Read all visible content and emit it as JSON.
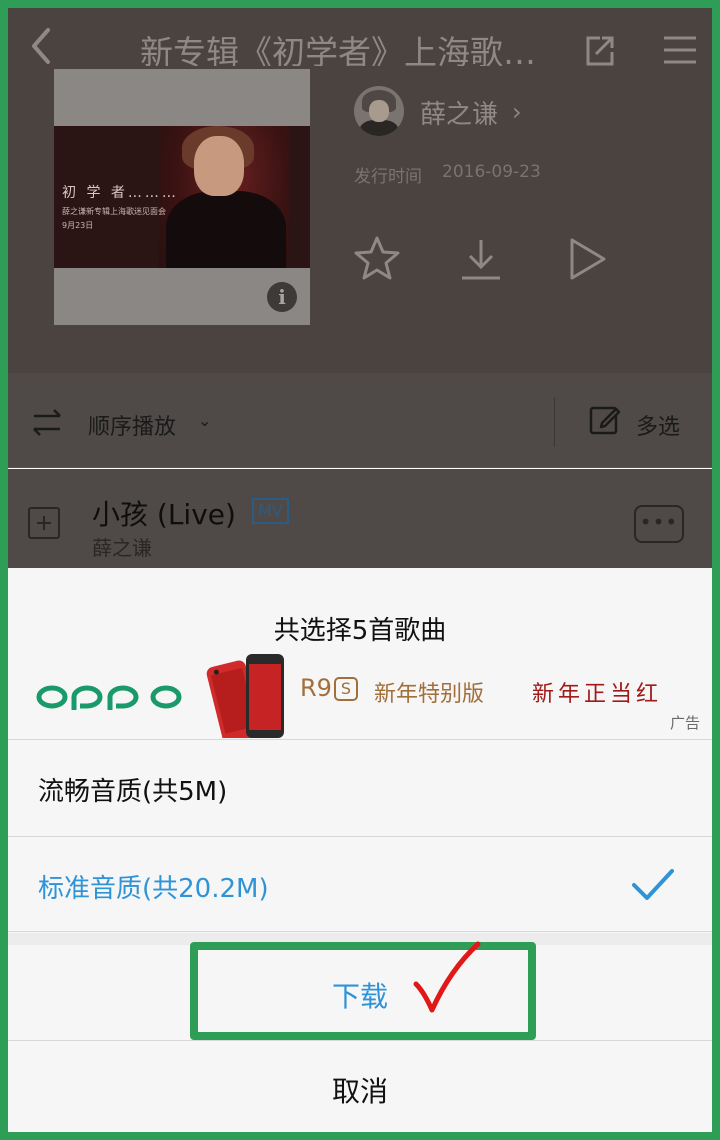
{
  "header": {
    "title": "新专辑《初学者》上海歌…",
    "artist": "薛之谦",
    "release_label": "发行时间",
    "release_date": "2016-09-23",
    "cover": {
      "line1": "初 学 者………",
      "line2": "薛之谦新专辑上海歌迷见面会",
      "line3": "9月23日"
    }
  },
  "toolbar": {
    "sequence_label": "顺序播放",
    "multi_select_label": "多选"
  },
  "song": {
    "title": "小孩 (Live)",
    "badge": "MV",
    "artist": "薛之谦"
  },
  "sheet": {
    "title": "共选择5首歌曲",
    "ad": {
      "brand": "OPPO",
      "model": "R9",
      "model_badge": "S",
      "edition": "新年特别版",
      "slogan": "新年正当红",
      "label": "广告"
    },
    "options": [
      {
        "label": "流畅音质(共5M)",
        "selected": false
      },
      {
        "label": "标准音质(共20.2M)",
        "selected": true
      }
    ],
    "download_label": "下载",
    "cancel_label": "取消"
  },
  "colors": {
    "accent_blue": "#2f93d8",
    "annotation_green": "#2e9e57",
    "annotation_red": "#e01818",
    "dim_overlay": "#4a4340",
    "ad_gold": "#a26f3a",
    "oppo_green": "#1a9a6a"
  },
  "icons": {
    "back": "chevron-left-icon",
    "share": "share-icon",
    "menu": "hamburger-menu-icon",
    "favorite": "star-icon",
    "download": "download-icon",
    "play": "play-icon",
    "sequence": "swap-arrows-icon",
    "multi_select": "edit-icon",
    "add": "plus-square-icon",
    "more": "more-dots-icon",
    "check": "check-icon"
  }
}
